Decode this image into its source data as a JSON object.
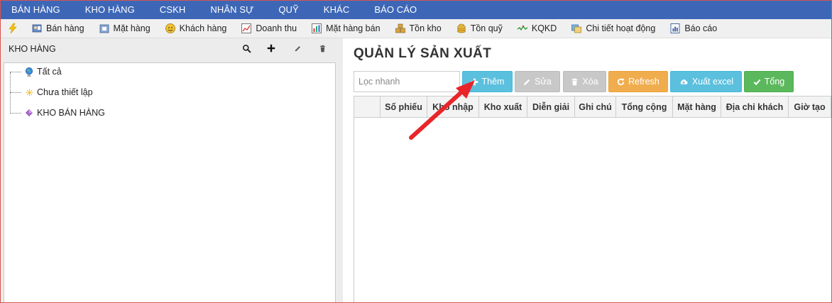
{
  "topnav": {
    "items": [
      "BÁN HÀNG",
      "KHO HÀNG",
      "CSKH",
      "NHÂN SỰ",
      "QUỸ",
      "KHÁC",
      "BÁO CÁO"
    ]
  },
  "toolbar": {
    "items": [
      {
        "label": "",
        "icon": "lightning-icon"
      },
      {
        "label": "Bán hàng",
        "icon": "cashier-icon"
      },
      {
        "label": "Mặt hàng",
        "icon": "box-icon"
      },
      {
        "label": "Khách hàng",
        "icon": "smiley-icon"
      },
      {
        "label": "Doanh thu",
        "icon": "revenue-chart-icon"
      },
      {
        "label": "Mặt hàng bán",
        "icon": "bar-chart-icon"
      },
      {
        "label": "Tồn kho",
        "icon": "stacked-boxes-icon"
      },
      {
        "label": "Tồn quỹ",
        "icon": "coins-icon"
      },
      {
        "label": "KQKD",
        "icon": "trend-line-icon"
      },
      {
        "label": "Chi tiết hoạt động",
        "icon": "activity-icon"
      },
      {
        "label": "Báo cáo",
        "icon": "report-icon"
      }
    ]
  },
  "left_panel": {
    "title": "KHO HÀNG",
    "tools": [
      "search-icon",
      "plus-icon",
      "pencil-icon",
      "trash-icon"
    ],
    "tree": [
      {
        "label": "Tất cả",
        "icon": "globe-icon"
      },
      {
        "label": "Chưa thiết lập",
        "icon": "star-icon"
      },
      {
        "label": "KHO BÁN HÀNG",
        "icon": "gem-icon"
      }
    ]
  },
  "main": {
    "title": "QUẢN LÝ SẢN XUẤT",
    "search_placeholder": "Lọc nhanh",
    "buttons": {
      "add": "Thêm",
      "edit": "Sửa",
      "delete": "Xóa",
      "refresh": "Refresh",
      "export": "Xuất excel",
      "total": "Tổng"
    },
    "columns": [
      "",
      "Số phiếu",
      "Kho nhập",
      "Kho xuất",
      "Diễn giải",
      "Ghi chú",
      "Tổng cộng",
      "Mặt hàng",
      "Địa chỉ khách",
      "Giờ tạo"
    ]
  },
  "colors": {
    "nav_bg": "#3d67b6",
    "add_btn": "#5bc0de",
    "refresh_btn": "#f0ad4e",
    "total_btn": "#5cb85c",
    "disabled_btn": "#c8c8c8",
    "arrow": "#e8262a"
  }
}
